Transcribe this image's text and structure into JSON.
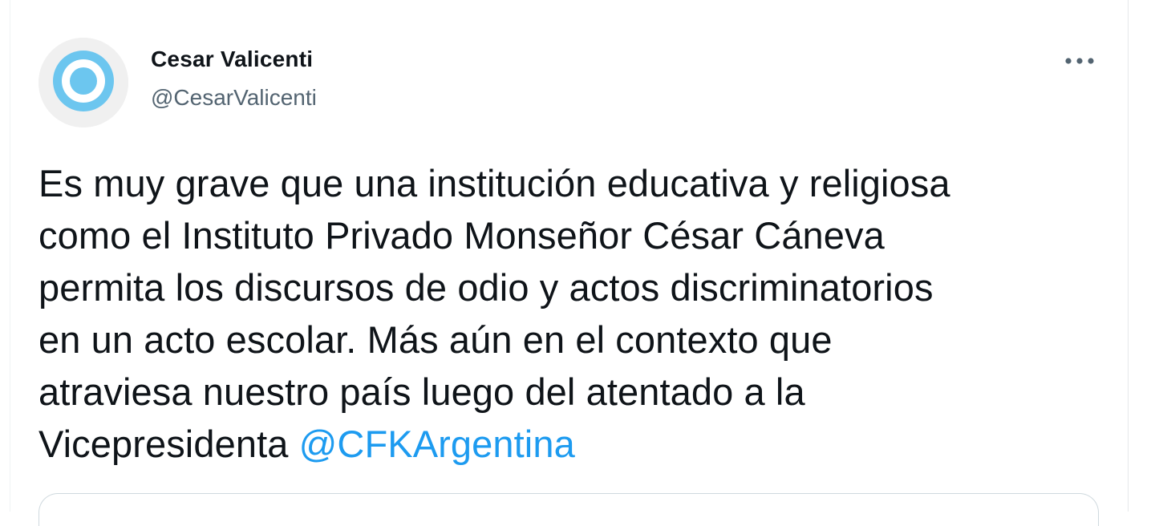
{
  "tweet": {
    "author": {
      "display_name": "Cesar Valicenti",
      "handle": "@CesarValicenti"
    },
    "body_lines": [
      "Es muy grave que una institución educativa y religiosa",
      "como el Instituto Privado Monseñor César Cáneva",
      "permita los discursos de odio y actos discriminatorios",
      "en un acto escolar. Más aún en el contexto que",
      "atraviesa nuestro país luego del atentado a la"
    ],
    "last_line_prefix": "Vicepresidenta ",
    "mention": "@CFKArgentina"
  },
  "icons": {
    "avatar": "argentina-sun-avatar-icon",
    "more": "more-options-icon"
  },
  "colors": {
    "text": "#0f1419",
    "secondary": "#536471",
    "link": "#1d9bf0",
    "avatar_blue": "#6cc6ef"
  }
}
